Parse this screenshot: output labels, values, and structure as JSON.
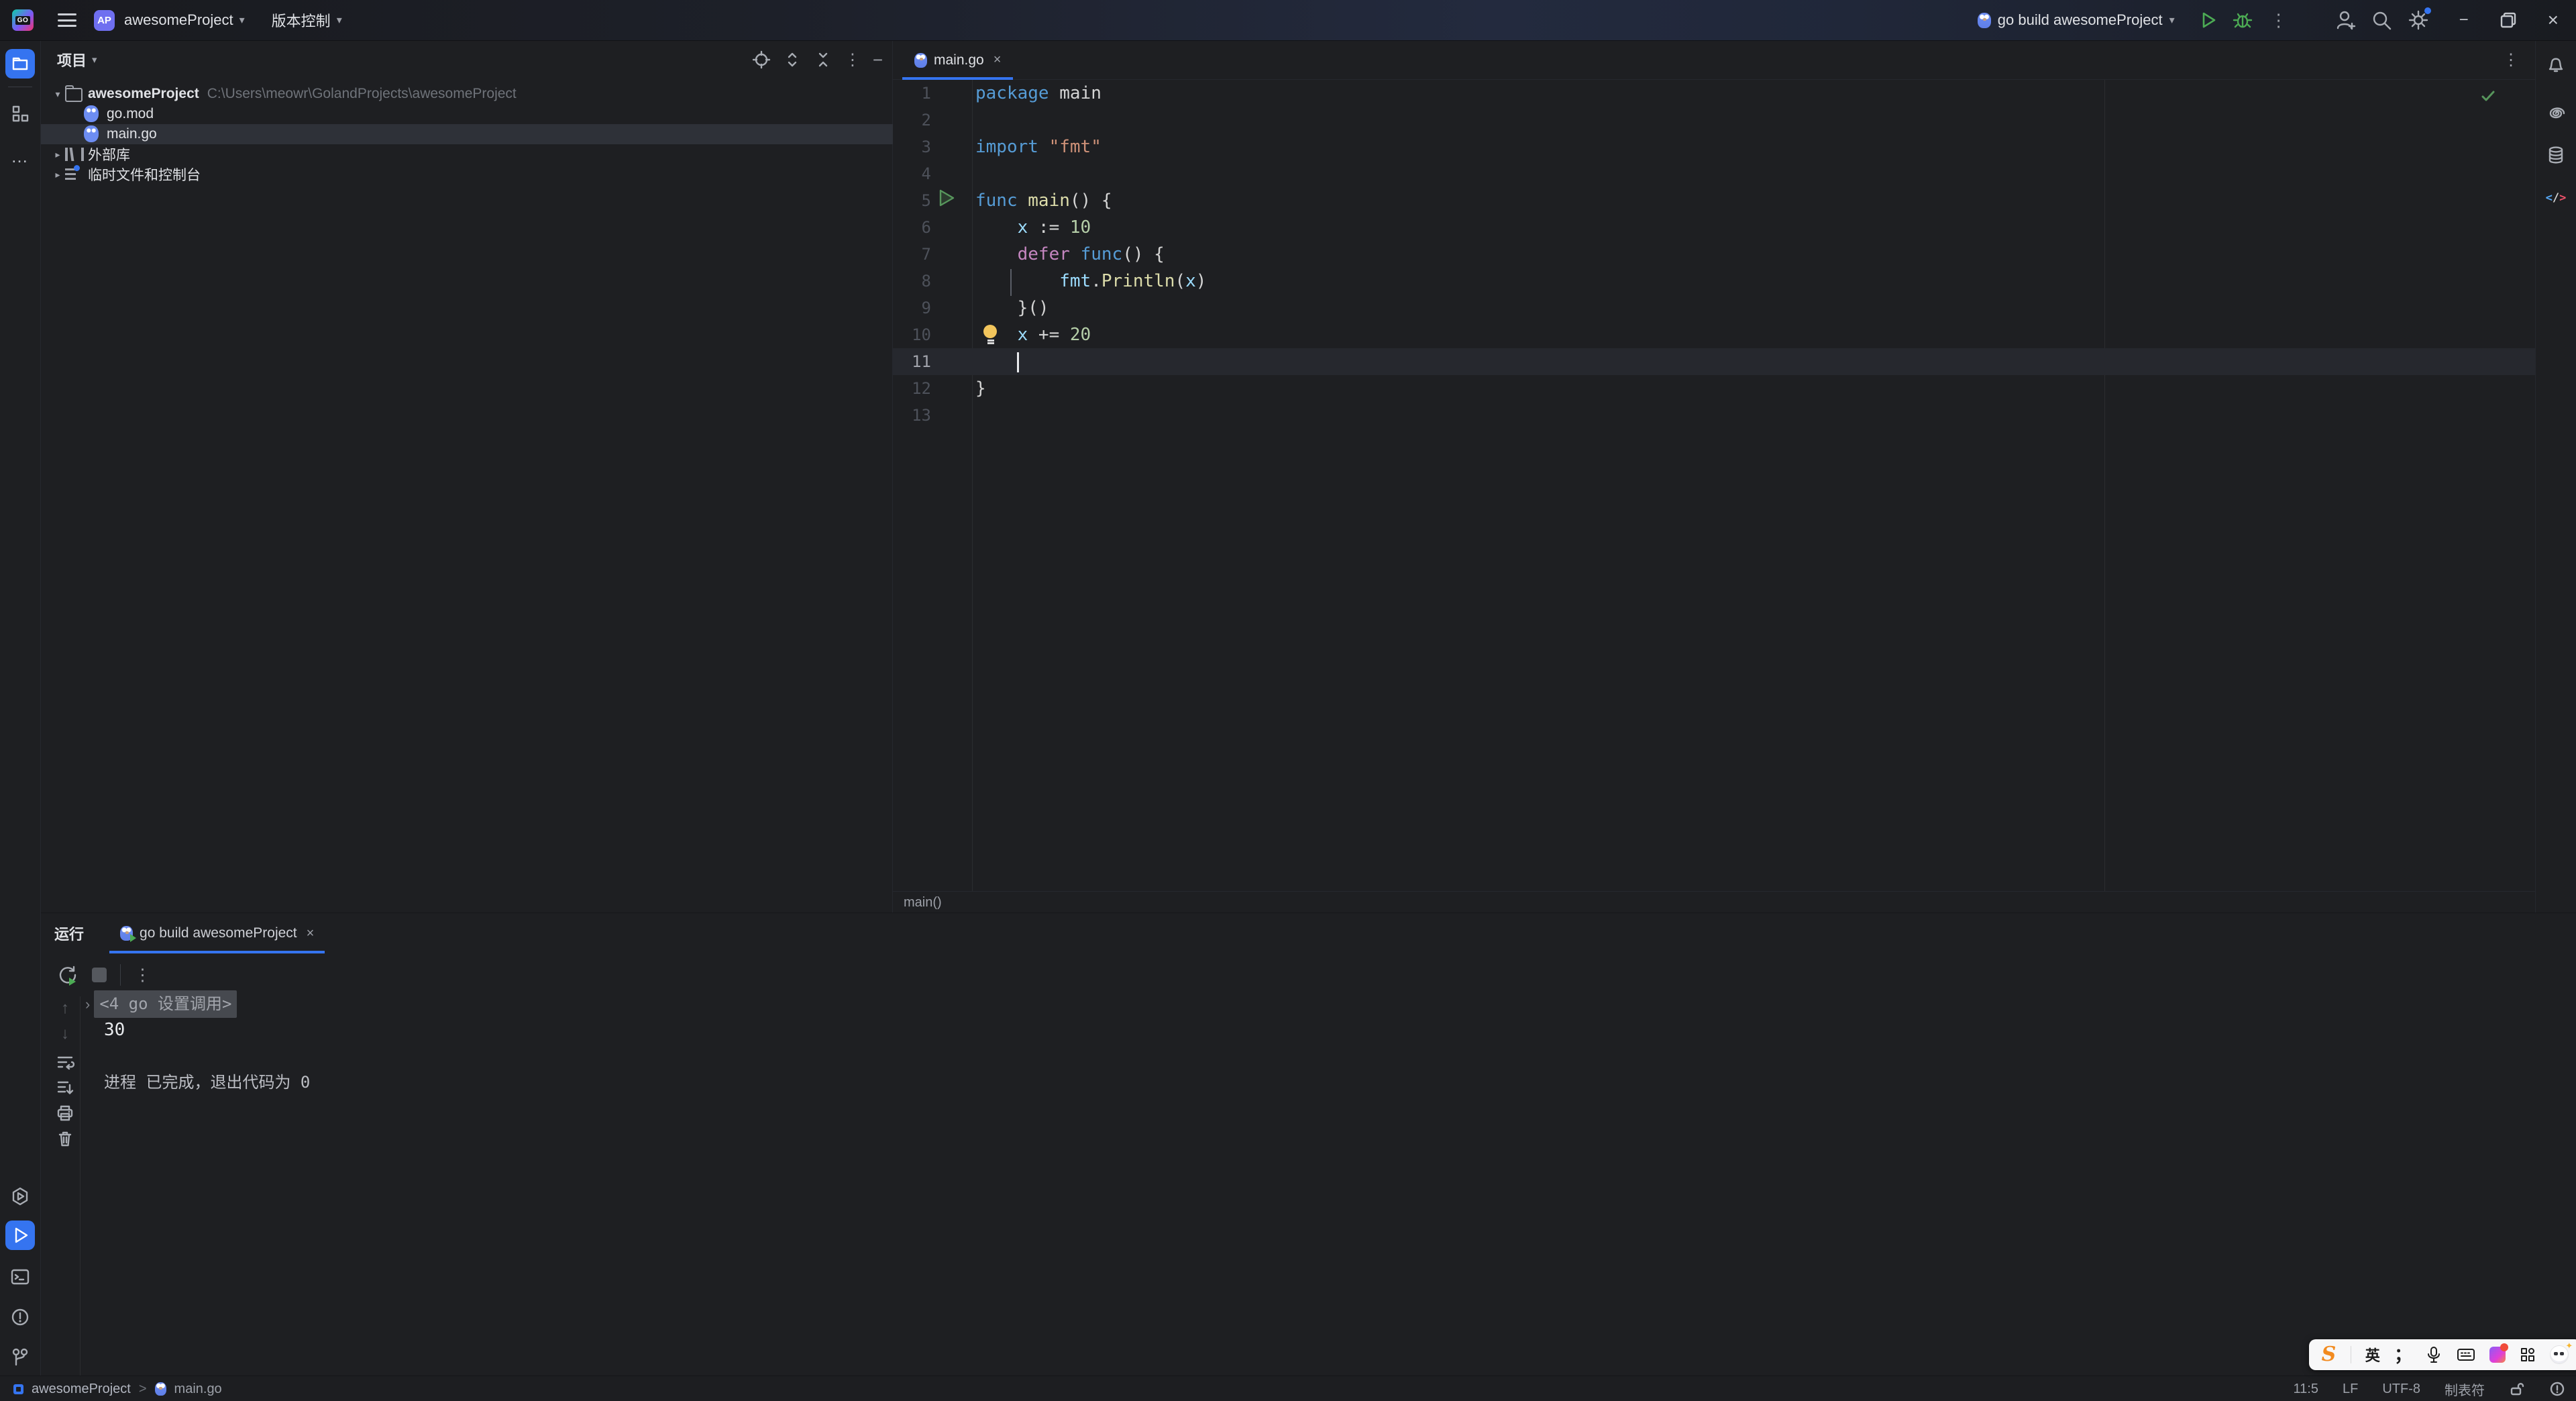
{
  "titlebar": {
    "logo_text": "GO",
    "project_badge": "AP",
    "project_name": "awesomeProject",
    "vcs_label": "版本控制",
    "run_config_label": "go build awesomeProject"
  },
  "icons": {
    "kebab": "⋮",
    "ellipsis": "…",
    "minus": "−",
    "close": "×",
    "restore": "❐",
    "chevron_down": "▾",
    "chevron_right": "▸",
    "chevron_expand": "∨",
    "fold_arrow": "›",
    "arrow_up": "↑",
    "arrow_down": "↓",
    "lt": "<",
    "slash": "/",
    "gt": ">",
    "ai_spiral": "@",
    "breadcrumb_sep": ">"
  },
  "colors": {
    "accent_blue": "#3574f0",
    "keyword": "#569cd6",
    "control_keyword": "#c586c0",
    "function": "#dcdcaa",
    "string": "#ce9178",
    "number": "#b5cea8",
    "variable": "#9cdcfe",
    "run_green": "#4cab54",
    "bulb_yellow": "#f2c55c",
    "editor_bg": "#1e1f22"
  },
  "project_panel": {
    "title": "项目",
    "tree": [
      {
        "icon": "folder",
        "chevron": "down",
        "label": "awesomeProject",
        "bold": true,
        "path": "C:\\Users\\meowr\\GolandProjects\\awesomeProject",
        "level": 0,
        "selected": false
      },
      {
        "icon": "go",
        "label": "go.mod",
        "level": 1,
        "selected": false
      },
      {
        "icon": "go",
        "label": "main.go",
        "level": 1,
        "selected": true
      },
      {
        "icon": "lib",
        "chevron": "right",
        "label": "外部库",
        "level": 0,
        "selected": false
      },
      {
        "icon": "scratch",
        "chevron": "right",
        "label": "临时文件和控制台",
        "level": 0,
        "selected": false
      }
    ]
  },
  "editor": {
    "tab_label": "main.go",
    "breadcrumb": "main()",
    "code": {
      "lines": [
        {
          "n": 1,
          "tokens": [
            [
              "kw",
              "package"
            ],
            [
              "pun",
              " "
            ],
            [
              "def",
              "main"
            ]
          ]
        },
        {
          "n": 2,
          "tokens": []
        },
        {
          "n": 3,
          "tokens": [
            [
              "kw",
              "import"
            ],
            [
              "pun",
              " "
            ],
            [
              "str",
              "\"fmt\""
            ]
          ]
        },
        {
          "n": 4,
          "tokens": []
        },
        {
          "n": 5,
          "gutter": "run",
          "tokens": [
            [
              "kw",
              "func"
            ],
            [
              "pun",
              " "
            ],
            [
              "fn",
              "main"
            ],
            [
              "pun",
              "() {"
            ]
          ]
        },
        {
          "n": 6,
          "tokens": [
            [
              "pun",
              "    "
            ],
            [
              "var",
              "x"
            ],
            [
              "pun",
              " := "
            ],
            [
              "num",
              "10"
            ]
          ]
        },
        {
          "n": 7,
          "tokens": [
            [
              "pun",
              "    "
            ],
            [
              "ctrl",
              "defer"
            ],
            [
              "pun",
              " "
            ],
            [
              "kw",
              "func"
            ],
            [
              "pun",
              "() {"
            ]
          ]
        },
        {
          "n": 8,
          "tokens": [
            [
              "pun",
              "        "
            ],
            [
              "pkg",
              "fmt"
            ],
            [
              "pun",
              "."
            ],
            [
              "fn",
              "Println"
            ],
            [
              "pun",
              "("
            ],
            [
              "var",
              "x"
            ],
            [
              "pun",
              ")"
            ]
          ]
        },
        {
          "n": 9,
          "tokens": [
            [
              "pun",
              "    "
            ],
            [
              "pun",
              "}()"
            ]
          ]
        },
        {
          "n": 10,
          "gutter": "bulb",
          "tokens": [
            [
              "pun",
              "    "
            ],
            [
              "var",
              "x"
            ],
            [
              "pun",
              " += "
            ],
            [
              "num",
              "20"
            ]
          ]
        },
        {
          "n": 11,
          "current": true,
          "caret": true,
          "tokens": [
            [
              "pun",
              "    "
            ]
          ]
        },
        {
          "n": 12,
          "tokens": [
            [
              "pun",
              "}"
            ]
          ]
        },
        {
          "n": 13,
          "tokens": []
        }
      ]
    }
  },
  "run_panel": {
    "label": "运行",
    "tab_label": "go build awesomeProject",
    "console": [
      {
        "type": "command",
        "fold_text": "<4 go 设置调用>"
      },
      {
        "type": "stdout",
        "text": "30"
      },
      {
        "type": "blank"
      },
      {
        "type": "system",
        "text": "进程 已完成，退出代码为 0"
      }
    ]
  },
  "status_bar": {
    "project": "awesomeProject",
    "separator": ">",
    "file": "main.go",
    "caret_position": "11:5",
    "line_ending": "LF",
    "encoding": "UTF-8",
    "indent_style": "制表符"
  },
  "ime": {
    "brand": "S",
    "lang_mode": "英",
    "punctuation": "；"
  }
}
